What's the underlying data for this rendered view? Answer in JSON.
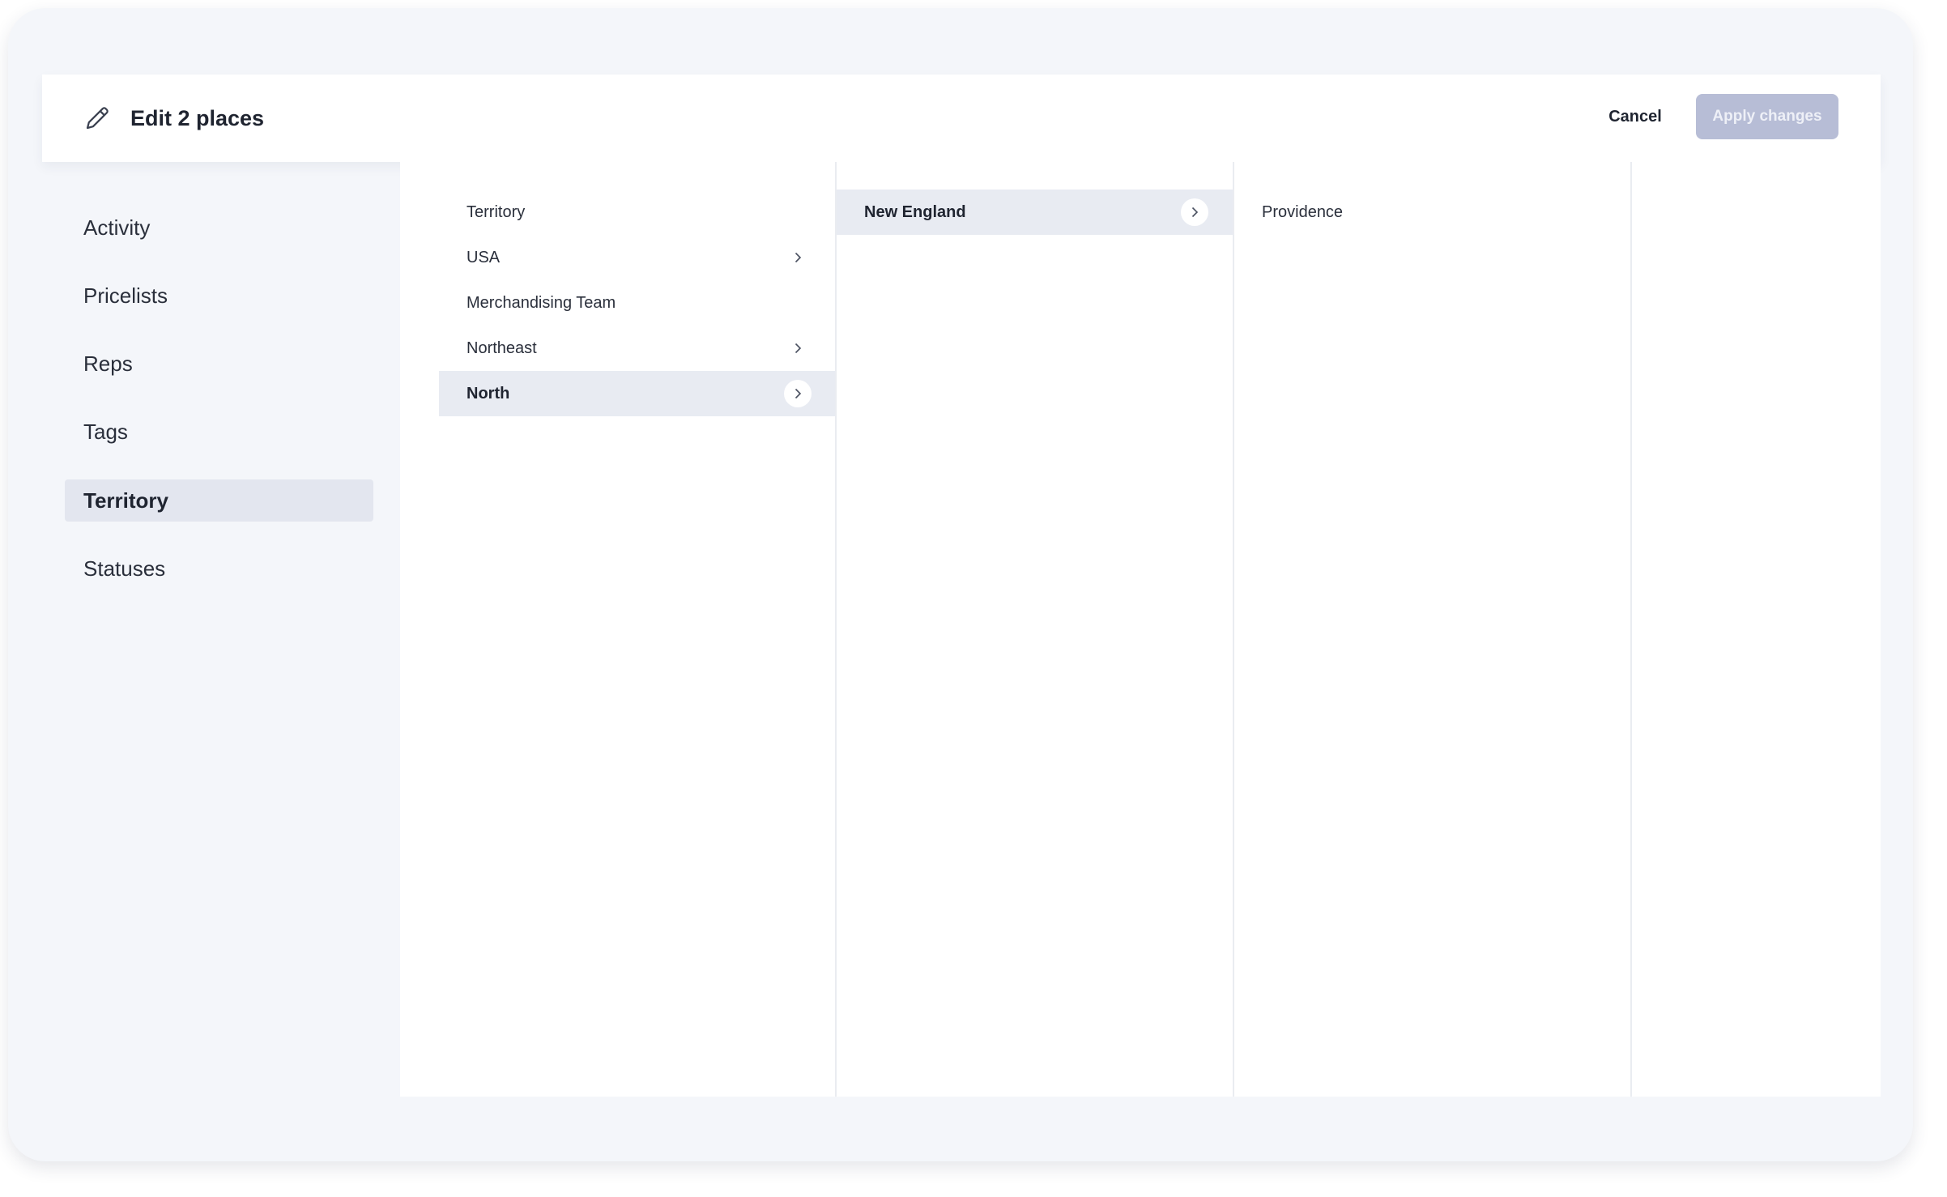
{
  "header": {
    "title": "Edit 2 places",
    "cancel_label": "Cancel",
    "apply_label": "Apply changes"
  },
  "sidebar": {
    "items": [
      {
        "label": "Activity"
      },
      {
        "label": "Pricelists"
      },
      {
        "label": "Reps"
      },
      {
        "label": "Tags"
      },
      {
        "label": "Territory",
        "active": true
      },
      {
        "label": "Statuses"
      }
    ]
  },
  "columns": {
    "col1": [
      {
        "label": "Territory",
        "has_children": false
      },
      {
        "label": "USA",
        "has_children": true
      },
      {
        "label": "Merchandising Team",
        "has_children": false
      },
      {
        "label": "Northeast",
        "has_children": true
      },
      {
        "label": "North",
        "has_children": true,
        "selected": true
      }
    ],
    "col2": [
      {
        "label": "New England",
        "has_children": true,
        "selected": true
      }
    ],
    "col3": [
      {
        "label": "Providence",
        "has_children": false
      }
    ]
  },
  "icons": {
    "edit": "pencil-icon",
    "chevron": "chevron-right-icon"
  },
  "colors": {
    "background": "#f4f6fa",
    "selected": "#e3e6ef",
    "apply_button": "#b7bdd6"
  }
}
